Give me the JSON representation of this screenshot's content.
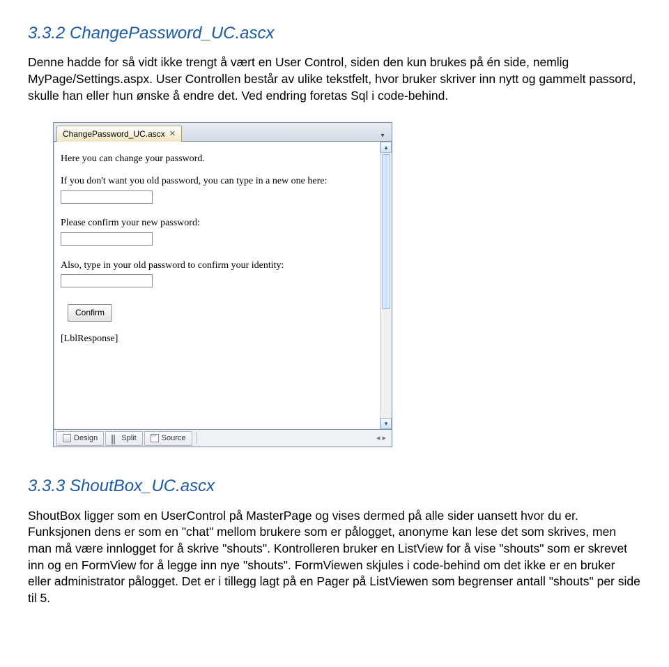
{
  "section1": {
    "heading": "3.3.2 ChangePassword_UC.ascx",
    "paragraph": "Denne hadde for så vidt ikke trengt å vært en User Control, siden den kun brukes på én side, nemlig MyPage/Settings.aspx. User Controllen består av ulike tekstfelt, hvor bruker skriver inn nytt og gammelt passord, skulle han eller hun ønske å endre det. Ved endring foretas Sql i code-behind."
  },
  "ide": {
    "tab_label": "ChangePassword_UC.ascx",
    "line1": "Here you can change your password.",
    "line2": "If you don't want you old password, you can type in a new one here:",
    "line3": "Please confirm your new password:",
    "line4": "Also, type in your old password to confirm your identity:",
    "confirm_label": "Confirm",
    "lbl_response": "[LblResponse]",
    "status": {
      "design": "Design",
      "split": "Split",
      "source": "Source"
    }
  },
  "section2": {
    "heading": "3.3.3 ShoutBox_UC.ascx",
    "paragraph": "ShoutBox ligger som en UserControl på MasterPage og vises dermed på alle sider uansett hvor du er. Funksjonen dens er som en \"chat\" mellom brukere som er pålogget, anonyme kan lese det som skrives, men man må være innlogget for å skrive \"shouts\". Kontrolleren bruker en ListView for å vise \"shouts\" som er skrevet inn og en FormView for å legge inn nye \"shouts\". FormViewen skjules i code-behind om det ikke er en bruker eller administrator pålogget. Det er i tillegg lagt på en Pager på ListViewen som begrenser antall \"shouts\" per side til 5."
  }
}
